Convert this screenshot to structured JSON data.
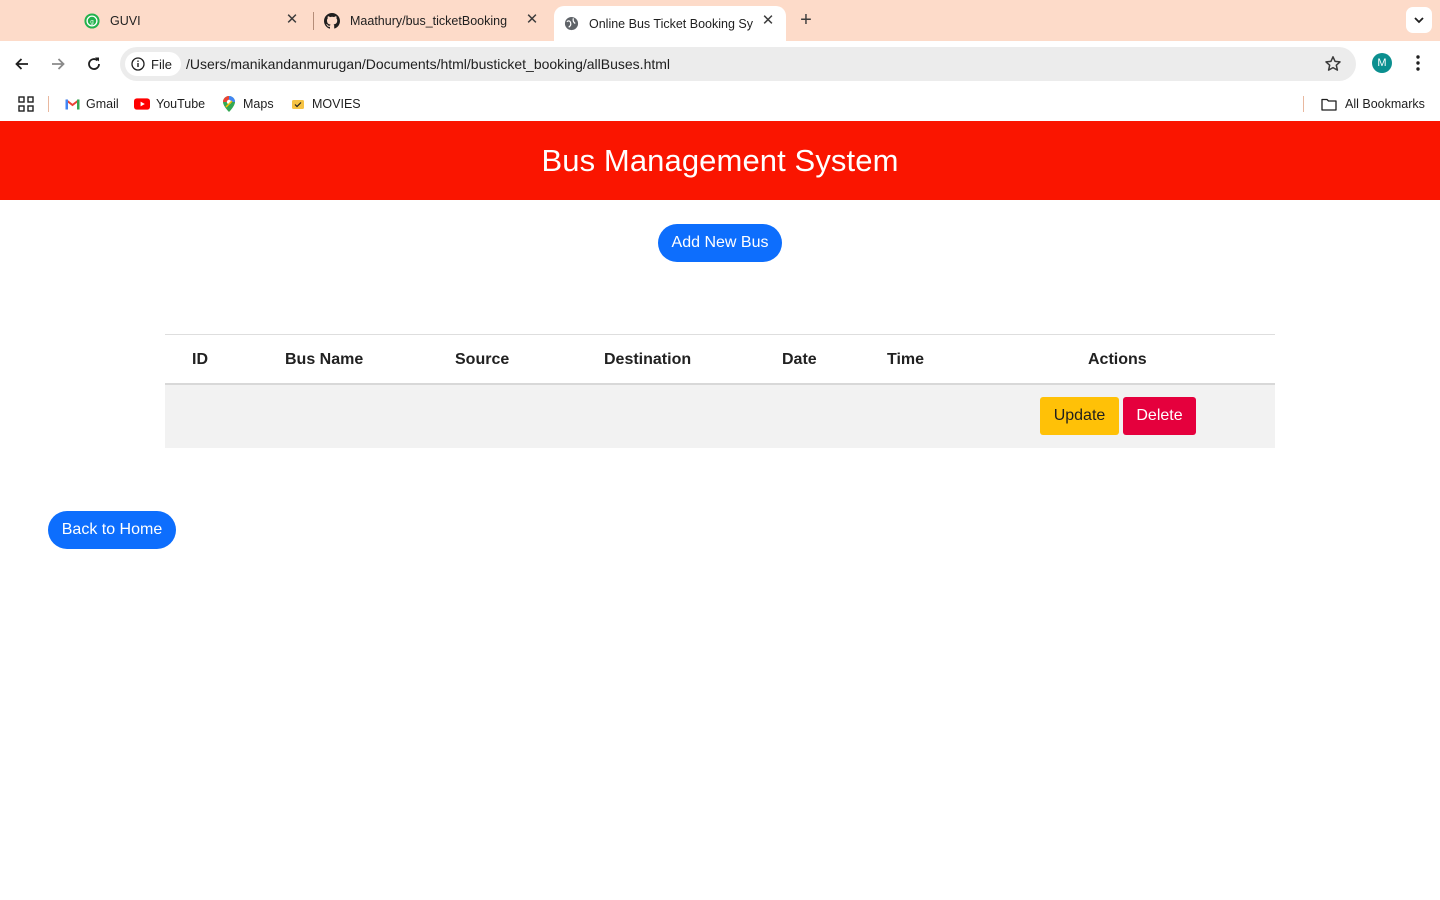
{
  "browser": {
    "tabs": [
      {
        "title": "GUVI",
        "icon": "guvi-icon"
      },
      {
        "title": "Maathury/bus_ticketBooking",
        "icon": "github-icon"
      },
      {
        "title": "Online Bus Ticket Booking Sy",
        "icon": "globe-icon",
        "active": true
      }
    ],
    "address": {
      "chip_label": "File",
      "url": "/Users/manikandanmurugan/Documents/html/busticket_booking/allBuses.html"
    },
    "profile_initial": "M",
    "bookmarks": [
      {
        "label": "Gmail",
        "icon": "gmail-icon"
      },
      {
        "label": "YouTube",
        "icon": "youtube-icon"
      },
      {
        "label": "Maps",
        "icon": "maps-icon"
      },
      {
        "label": "MOVIES",
        "icon": "movies-icon"
      }
    ],
    "all_bookmarks_label": "All Bookmarks",
    "colors": {
      "tabstrip": "#fddbc9",
      "omnibox": "#ececec",
      "profile": "#0b8f8f"
    }
  },
  "page": {
    "header_title": "Bus Management System",
    "add_button_label": "Add New Bus",
    "table": {
      "columns": [
        "ID",
        "Bus Name",
        "Source",
        "Destination",
        "Date",
        "Time",
        "Actions"
      ],
      "rows": [
        {
          "id": "",
          "bus_name": "",
          "source": "",
          "destination": "",
          "date": "",
          "time": "",
          "update_label": "Update",
          "delete_label": "Delete"
        }
      ]
    },
    "back_button_label": "Back to Home",
    "colors": {
      "header": "#fa1500",
      "primary": "#0d6efd",
      "update": "#ffc107",
      "delete": "#e5003d"
    }
  }
}
